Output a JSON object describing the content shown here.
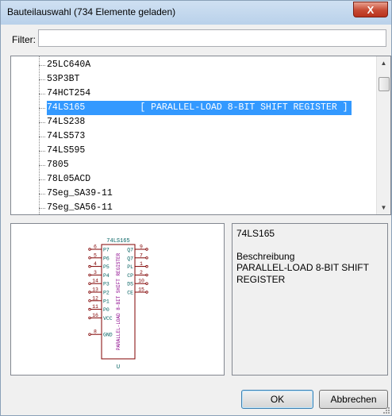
{
  "window": {
    "title": "Bauteilauswahl (734 Elemente geladen)",
    "close_label": "X"
  },
  "filter": {
    "label": "Filter:",
    "value": ""
  },
  "tree": {
    "items": [
      {
        "label": "25LC640A"
      },
      {
        "label": "53P3BT"
      },
      {
        "label": "74HCT254"
      },
      {
        "label": "74LS165          [ PARALLEL-LOAD 8-BIT SHIFT REGISTER ]",
        "selected": true
      },
      {
        "label": "74LS238"
      },
      {
        "label": "74LS573"
      },
      {
        "label": "74LS595"
      },
      {
        "label": "7805"
      },
      {
        "label": "78L05ACD"
      },
      {
        "label": "7Seg_SA39-11"
      },
      {
        "label": "7Seg_SA56-11"
      }
    ]
  },
  "preview": {
    "part_name": "74LS165",
    "body_label": "PARALLEL-LOAD 8-BIT SHIFT REGISTER",
    "unit_label": "U",
    "left_pins": [
      {
        "num": "6",
        "name": "P7"
      },
      {
        "num": "5",
        "name": "P6"
      },
      {
        "num": "4",
        "name": "P5"
      },
      {
        "num": "3",
        "name": "P4"
      },
      {
        "num": "14",
        "name": "P3"
      },
      {
        "num": "13",
        "name": "P2"
      },
      {
        "num": "12",
        "name": "P1"
      },
      {
        "num": "11",
        "name": "P0"
      },
      {
        "num": "16",
        "name": "VCC"
      },
      {
        "num": "8",
        "name": "GND"
      }
    ],
    "right_pins": [
      {
        "num": "9",
        "name": "Q7"
      },
      {
        "num": "7",
        "name": "Q7"
      },
      {
        "num": "1",
        "name": "PL"
      },
      {
        "num": "2",
        "name": "CP"
      },
      {
        "num": "10",
        "name": "DS"
      },
      {
        "num": "15",
        "name": "CE"
      }
    ]
  },
  "info": {
    "name": "74LS165",
    "description_label": "Beschreibung",
    "description": "PARALLEL-LOAD 8-BIT SHIFT REGISTER"
  },
  "buttons": {
    "ok": "OK",
    "cancel": "Abbrechen"
  },
  "colors": {
    "selection": "#3399ff",
    "schematic_body": "#800000",
    "schematic_pin_text": "#006060",
    "schematic_name_text": "#8a008a"
  }
}
